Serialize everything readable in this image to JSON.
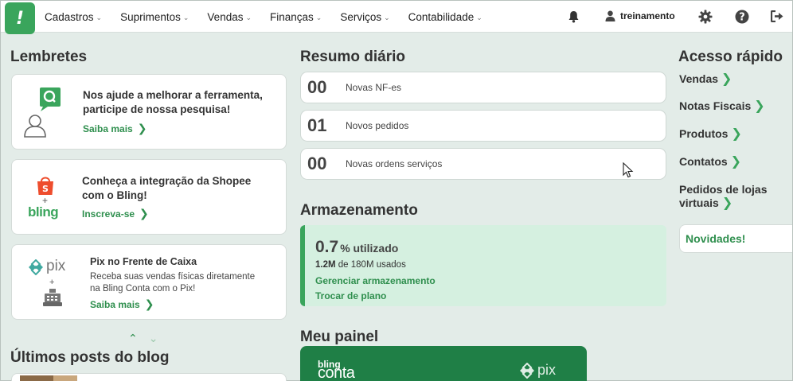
{
  "nav": {
    "items": [
      {
        "label": "Cadastros"
      },
      {
        "label": "Suprimentos"
      },
      {
        "label": "Vendas"
      },
      {
        "label": "Finanças"
      },
      {
        "label": "Serviços"
      },
      {
        "label": "Contabilidade"
      }
    ],
    "user": "treinamento"
  },
  "lembretes": {
    "title": "Lembretes",
    "cards": [
      {
        "title": "Nos ajude a melhorar a ferramenta, participe de nossa pesquisa!",
        "link": "Saiba mais"
      },
      {
        "title": "Conheça a integração da Shopee com o Bling!",
        "link": "Inscreva-se",
        "logo_text": "bling"
      },
      {
        "title": "Pix no Frente de Caixa",
        "desc": "Receba suas vendas físicas diretamente na Bling Conta com o Pix!",
        "link": "Saiba mais",
        "logo_text": "pix"
      }
    ]
  },
  "blog": {
    "title": "Últimos posts do blog"
  },
  "resumo": {
    "title": "Resumo diário",
    "items": [
      {
        "count": "00",
        "label": "Novas NF-es"
      },
      {
        "count": "01",
        "label": "Novos pedidos"
      },
      {
        "count": "00",
        "label": "Novas ordens serviços"
      }
    ]
  },
  "armazenamento": {
    "title": "Armazenamento",
    "percent": "0.7",
    "percent_unit": "% utilizado",
    "used": "1.2M",
    "used_suffix": "de 180M usados",
    "manage_link": "Gerenciar armazenamento",
    "plan_link": "Trocar de plano"
  },
  "painel": {
    "title": "Meu painel",
    "banner_brand_top": "bling",
    "banner_brand_bottom": "conta",
    "banner_pix": "pix"
  },
  "acesso": {
    "title": "Acesso rápido",
    "items": [
      {
        "label": "Vendas"
      },
      {
        "label": "Notas Fiscais"
      },
      {
        "label": "Produtos"
      },
      {
        "label": "Contatos"
      },
      {
        "label": "Pedidos de lojas virtuais"
      }
    ],
    "novidades": "Novidades!"
  },
  "colors": {
    "brand_green": "#3aa55c",
    "link_green": "#2f8f4e",
    "background": "#e3ece8"
  },
  "icons": {
    "logo": "bling-logo-icon",
    "bell": "bell-icon",
    "user": "user-icon",
    "gear": "gear-icon",
    "help": "help-icon",
    "logout": "logout-icon"
  }
}
